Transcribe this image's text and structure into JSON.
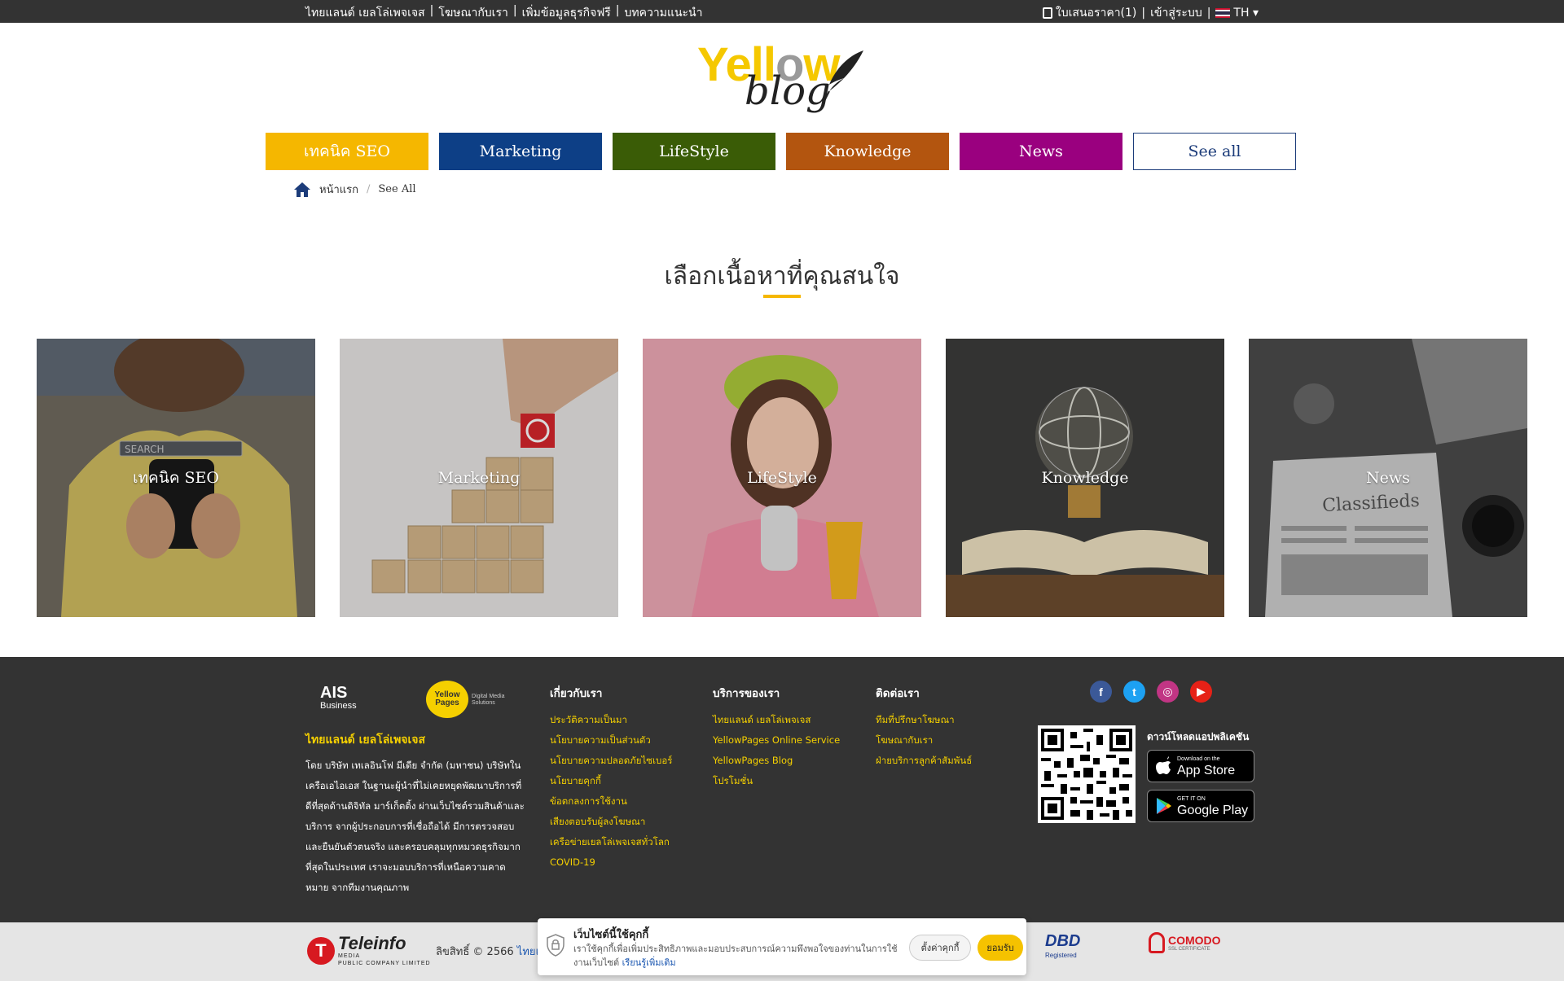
{
  "topbar": {
    "links_left": [
      "ไทยแลนด์ เยลโล่เพจเจส",
      "โฆษณากับเรา",
      "เพิ่มข้อมูลธุรกิจฟรี",
      "บทความแนะนำ"
    ],
    "quote_label": "ใบเสนอราคา(1)",
    "login_label": "เข้าสู่ระบบ",
    "language": "TH"
  },
  "logo": {
    "part1": "Yell",
    "part2": "o",
    "part3": "w",
    "script": "blog"
  },
  "categories": [
    {
      "label": "เทคนิค SEO",
      "color": "#f5b700"
    },
    {
      "label": "Marketing",
      "color": "#0d3f86"
    },
    {
      "label": "LifeStyle",
      "color": "#3a5c06"
    },
    {
      "label": "Knowledge",
      "color": "#b3550f"
    },
    {
      "label": "News",
      "color": "#9a007f"
    },
    {
      "label": "See all",
      "color": "#ffffff"
    }
  ],
  "breadcrumb": {
    "home": "หน้าแรก",
    "current": "See All"
  },
  "section_title": "เลือกเนื้อหาที่คุณสนใจ",
  "tiles": [
    {
      "label": "เทคนิค SEO",
      "search_text": "SEARCH"
    },
    {
      "label": "Marketing"
    },
    {
      "label": "LifeStyle"
    },
    {
      "label": "Knowledge"
    },
    {
      "label": "News",
      "newspaper_text": "Classifieds"
    }
  ],
  "footer": {
    "ais_logo": "AIS",
    "ais_sub": "Business",
    "yp_logo": "Yellow Pages",
    "yp_sub": "Digital Media Solutions",
    "brand": "ไทยแลนด์ เยลโล่เพจเจส",
    "about": "โดย บริษัท เทเลอินโฟ มีเดีย จำกัด (มหาชน) บริษัทในเครือเอไอเอส ในฐานะผู้นำที่ไม่เคยหยุดพัฒนาบริการที่ดีที่สุดด้านดิจิทัล มาร์เก็ตติ้ง ผ่านเว็บไซต์รวมสินค้าและบริการ จากผู้ประกอบการที่เชื่อถือได้ มีการตรวจสอบและยืนยันตัวตนจริง และครอบคลุมทุกหมวดธุรกิจมากที่สุดในประเทศ เราจะมอบบริการที่เหนือความคาดหมาย จากทีมงานคุณภาพ",
    "col1": {
      "title": "เกี่ยวกับเรา",
      "links": [
        "ประวัติความเป็นมา",
        "นโยบายความเป็นส่วนตัว",
        "นโยบายความปลอดภัยไซเบอร์",
        "นโยบายคุกกี้",
        "ข้อตกลงการใช้งาน",
        "เสียงตอบรับผู้ลงโฆษณา",
        "เครือข่ายเยลโล่เพจเจสทั่วโลก",
        "COVID-19"
      ]
    },
    "col2": {
      "title": "บริการของเรา",
      "links": [
        "ไทยแลนด์ เยลโล่เพจเจส",
        "YellowPages Online Service",
        "YellowPages Blog",
        "โปรโมชั่น"
      ]
    },
    "col3": {
      "title": "ติดต่อเรา",
      "links": [
        "ทีมที่ปรึกษาโฆษณา",
        "โฆษณากับเรา",
        "ฝ่ายบริการลูกค้าสัมพันธ์"
      ]
    },
    "social": {
      "facebook": "f",
      "twitter": "t",
      "instagram": "◎",
      "youtube": "▶"
    },
    "app_title": "ดาวน์โหลดแอปพลิเคชัน",
    "appstore_small": "Download on the",
    "appstore": "App Store",
    "gplay_small": "GET IT ON",
    "gplay": "Google Play"
  },
  "bottom": {
    "teleinfo_logo": "Teleinfo",
    "teleinfo_media": "MEDIA",
    "teleinfo_sub": "PUBLIC COMPANY LIMITED",
    "copyright": "ลิขสิทธิ์ © 2566",
    "copyright_link": "ไทยแ",
    "dbd_logo": "DBD",
    "dbd_sub": "Registered",
    "comodo_logo": "COMODO",
    "comodo_sub": "SSL CERTIFICATE"
  },
  "cookie": {
    "title": "เว็บไซต์นี้ใช้คุกกี้",
    "body": "เราใช้คุกกี้เพื่อเพิ่มประสิทธิภาพและมอบประสบการณ์ความพึงพอใจของท่านในการใช้งานเว็บไซต์",
    "learn_more": "เรียนรู้เพิ่มเติม",
    "settings": "ตั้งค่าคุกกี้",
    "accept": "ยอมรับ"
  }
}
